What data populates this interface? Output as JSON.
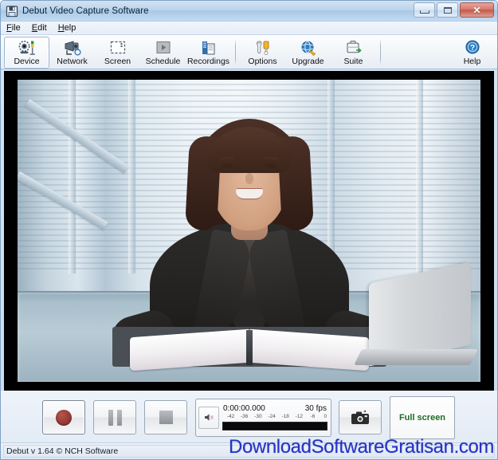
{
  "window": {
    "title": "Debut Video Capture Software",
    "title_icon": "save-floppy-icon",
    "buttons": {
      "minimize": "minimize-icon",
      "maximize": "maximize-icon",
      "close": "✕"
    }
  },
  "menubar": {
    "items": [
      {
        "label": "File",
        "mnemonic": "F"
      },
      {
        "label": "Edit",
        "mnemonic": "E"
      },
      {
        "label": "Help",
        "mnemonic": "H"
      }
    ]
  },
  "toolbar": {
    "items": [
      {
        "label": "Device",
        "icon": "webcam-device-icon",
        "selected": true
      },
      {
        "label": "Network",
        "icon": "network-camera-icon",
        "selected": false
      },
      {
        "label": "Screen",
        "icon": "screen-capture-icon",
        "selected": false
      },
      {
        "label": "Schedule",
        "icon": "schedule-icon",
        "selected": false
      },
      {
        "label": "Recordings",
        "icon": "recordings-icon",
        "selected": false
      },
      {
        "label": "Options",
        "icon": "options-tools-icon",
        "selected": false
      },
      {
        "label": "Upgrade",
        "icon": "upgrade-globe-icon",
        "selected": false
      },
      {
        "label": "Suite",
        "icon": "suite-briefcase-icon",
        "selected": false
      }
    ],
    "help": {
      "label": "Help",
      "icon": "help-question-icon"
    }
  },
  "preview": {
    "description": "Live webcam preview: businesswoman in dark suit seated at a desk with an open book, pen in hand and a laptop to her right, glass office windows behind."
  },
  "controls": {
    "record": {
      "label": "Record",
      "icon": "record-circle-icon"
    },
    "pause": {
      "label": "Pause",
      "icon": "pause-bars-icon"
    },
    "stop": {
      "label": "Stop",
      "icon": "stop-square-icon"
    },
    "mute": {
      "label": "Mute",
      "icon": "speaker-mute-icon"
    },
    "snapshot": {
      "label": "Snapshot",
      "icon": "camera-snapshot-icon"
    },
    "fullscreen": {
      "label": "Full screen"
    }
  },
  "meter": {
    "timecode": "0:00:00.000",
    "fps": "30 fps",
    "scale_labels": [
      "-42",
      "-36",
      "-30",
      "-24",
      "-18",
      "-12",
      "-6",
      "0"
    ],
    "level_percent": 0
  },
  "statusbar": {
    "text": "Debut v 1.64 © NCH Software"
  },
  "watermark": {
    "text": "DownloadSoftwareGratisan.com",
    "color": "#2633c2"
  },
  "colors": {
    "titlebar_blue": "#bcd4ec",
    "chrome": "#e3ebf5",
    "fullscreen_green": "#1f6b25",
    "record_red": "#9c3f38",
    "close_red": "#c05a4c"
  }
}
